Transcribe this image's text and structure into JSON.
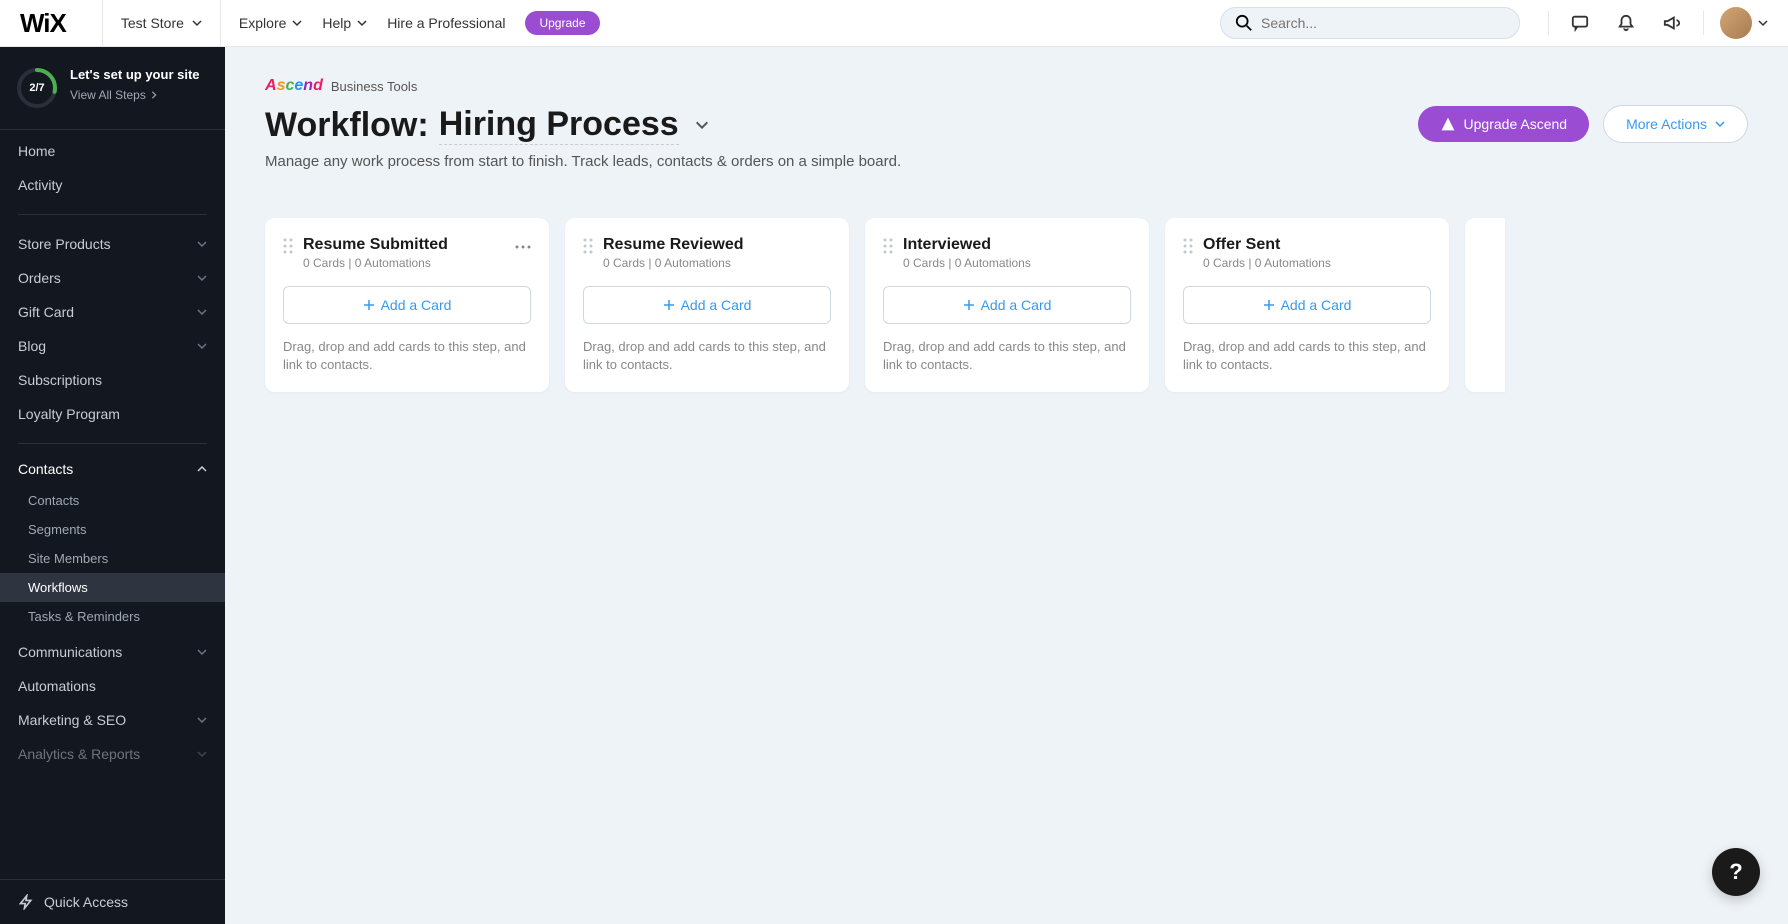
{
  "topbar": {
    "logo": "WiX",
    "site_name": "Test Store",
    "explore": "Explore",
    "help": "Help",
    "hire": "Hire a Professional",
    "upgrade": "Upgrade",
    "search_placeholder": "Search..."
  },
  "sidebar": {
    "setup": {
      "progress": "2/7",
      "title": "Let's set up your site",
      "view_all": "View All Steps"
    },
    "nav_top": [
      {
        "label": "Home"
      },
      {
        "label": "Activity"
      }
    ],
    "nav_store": [
      {
        "label": "Store Products",
        "chevron": true
      },
      {
        "label": "Orders",
        "chevron": true
      },
      {
        "label": "Gift Card",
        "chevron": true
      },
      {
        "label": "Blog",
        "chevron": true
      },
      {
        "label": "Subscriptions"
      },
      {
        "label": "Loyalty Program"
      }
    ],
    "contacts_label": "Contacts",
    "contacts_sub": [
      {
        "label": "Contacts"
      },
      {
        "label": "Segments"
      },
      {
        "label": "Site Members"
      },
      {
        "label": "Workflows",
        "active": true
      },
      {
        "label": "Tasks & Reminders"
      }
    ],
    "nav_bottom": [
      {
        "label": "Communications",
        "chevron": true
      },
      {
        "label": "Automations"
      },
      {
        "label": "Marketing & SEO",
        "chevron": true
      },
      {
        "label": "Analytics & Reports",
        "chevron": true,
        "faded": true
      }
    ],
    "quick_access": "Quick Access"
  },
  "breadcrumb": {
    "ascend": "Ascend",
    "suffix": "Business Tools"
  },
  "header": {
    "title_prefix": "Workflow: ",
    "title_name": "Hiring Process",
    "subtitle": "Manage any work process from start to finish. Track leads, contacts & orders on a simple board.",
    "upgrade_btn": "Upgrade Ascend",
    "more_btn": "More Actions"
  },
  "columns": [
    {
      "title": "Resume Submitted",
      "meta": "0 Cards  |  0 Automations",
      "add": "Add a Card",
      "hint": "Drag, drop and add cards to this step, and link to contacts.",
      "show_menu": true
    },
    {
      "title": "Resume Reviewed",
      "meta": "0 Cards  |  0 Automations",
      "add": "Add a Card",
      "hint": "Drag, drop and add cards to this step, and link to contacts."
    },
    {
      "title": "Interviewed",
      "meta": "0 Cards  |  0 Automations",
      "add": "Add a Card",
      "hint": "Drag, drop and add cards to this step, and link to contacts."
    },
    {
      "title": "Offer Sent",
      "meta": "0 Cards  |  0 Automations",
      "add": "Add a Card",
      "hint": "Drag, drop and add cards to this step, and link to contacts."
    }
  ]
}
